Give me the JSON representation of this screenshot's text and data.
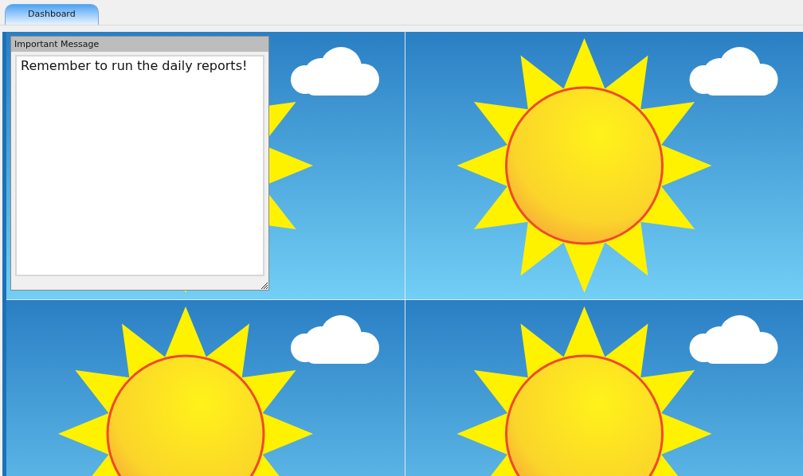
{
  "tabs": [
    {
      "label": "Dashboard",
      "selected": true
    }
  ],
  "message_widget": {
    "title": "Important Message",
    "text": "Remember to run the daily reports!"
  }
}
